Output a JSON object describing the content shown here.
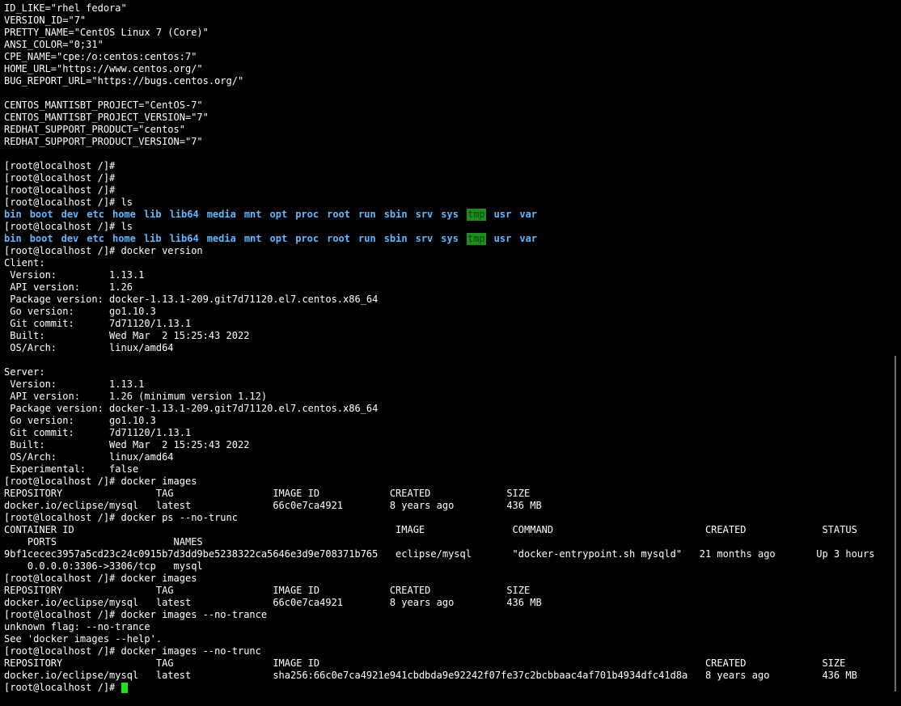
{
  "terminal": {
    "lines_before": [
      "ID_LIKE=\"rhel fedora\"",
      "VERSION_ID=\"7\"",
      "PRETTY_NAME=\"CentOS Linux 7 (Core)\"",
      "ANSI_COLOR=\"0;31\"",
      "CPE_NAME=\"cpe:/o:centos:centos:7\"",
      "HOME_URL=\"https://www.centos.org/\"",
      "BUG_REPORT_URL=\"https://bugs.centos.org/\"",
      "",
      "CENTOS_MANTISBT_PROJECT=\"CentOS-7\"",
      "CENTOS_MANTISBT_PROJECT_VERSION=\"7\"",
      "REDHAT_SUPPORT_PRODUCT=\"centos\"",
      "REDHAT_SUPPORT_PRODUCT_VERSION=\"7\"",
      "",
      "[root@localhost /]#",
      "[root@localhost /]#",
      "[root@localhost /]#",
      "[root@localhost /]# ls"
    ],
    "ls_output": [
      "bin",
      "boot",
      "dev",
      "etc",
      "home",
      "lib",
      "lib64",
      "media",
      "mnt",
      "opt",
      "proc",
      "root",
      "run",
      "sbin",
      "srv",
      "sys",
      "tmp",
      "usr",
      "var"
    ],
    "ls_prompt_2": "[root@localhost /]# ls",
    "lines_after": [
      "[root@localhost /]# docker version",
      "Client:",
      " Version:         1.13.1",
      " API version:     1.26",
      " Package version: docker-1.13.1-209.git7d71120.el7.centos.x86_64",
      " Go version:      go1.10.3",
      " Git commit:      7d71120/1.13.1",
      " Built:           Wed Mar  2 15:25:43 2022",
      " OS/Arch:         linux/amd64",
      "",
      "Server:",
      " Version:         1.13.1",
      " API version:     1.26 (minimum version 1.12)",
      " Package version: docker-1.13.1-209.git7d71120.el7.centos.x86_64",
      " Go version:      go1.10.3",
      " Git commit:      7d71120/1.13.1",
      " Built:           Wed Mar  2 15:25:43 2022",
      " OS/Arch:         linux/amd64",
      " Experimental:    false",
      "[root@localhost /]# docker images",
      "REPOSITORY                TAG                 IMAGE ID            CREATED             SIZE",
      "docker.io/eclipse/mysql   latest              66c0e7ca4921        8 years ago         436 MB",
      "[root@localhost /]# docker ps --no-trunc",
      "CONTAINER ID                                                       IMAGE               COMMAND                          CREATED             STATUS",
      "    PORTS                    NAMES",
      "9bf1cecec3957a5cd23c24c0915b7d3dd9be5238322ca5646e3d9e708371b765   eclipse/mysql       \"docker-entrypoint.sh mysqld\"   21 months ago       Up 3 hours",
      "    0.0.0.0:3306->3306/tcp   mysql",
      "[root@localhost /]# docker images",
      "REPOSITORY                TAG                 IMAGE ID            CREATED             SIZE",
      "docker.io/eclipse/mysql   latest              66c0e7ca4921        8 years ago         436 MB",
      "[root@localhost /]# docker images --no-trance",
      "unknown flag: --no-trance",
      "See 'docker images --help'.",
      "[root@localhost /]# docker images --no-trunc",
      "REPOSITORY                TAG                 IMAGE ID                                                                  CREATED             SIZE",
      "docker.io/eclipse/mysql   latest              sha256:66c0e7ca4921e941cbdbda9e92242f07fe37c2bcbbaac4af701b4934dfc41d8a   8 years ago         436 MB"
    ],
    "final_prompt": "[root@localhost /]# "
  },
  "colors": {
    "background": "#000000",
    "foreground": "#ffffff",
    "directory": "#5fb8ff",
    "tmp_highlight": "#1e8c1e",
    "cursor": "#1fe01f"
  }
}
